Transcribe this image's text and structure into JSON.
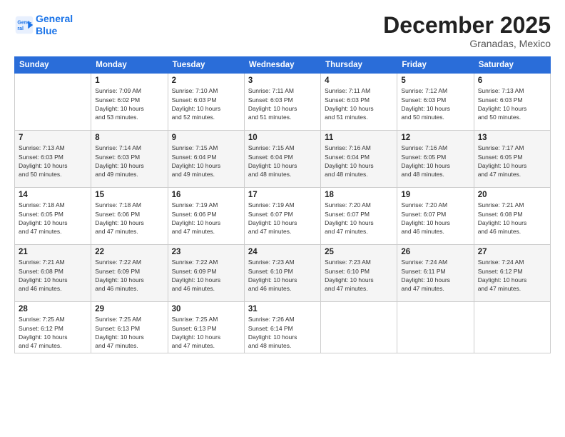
{
  "header": {
    "logo_line1": "General",
    "logo_line2": "Blue",
    "month_year": "December 2025",
    "location": "Granadas, Mexico"
  },
  "weekdays": [
    "Sunday",
    "Monday",
    "Tuesday",
    "Wednesday",
    "Thursday",
    "Friday",
    "Saturday"
  ],
  "weeks": [
    [
      {
        "day": "",
        "info": ""
      },
      {
        "day": "1",
        "info": "Sunrise: 7:09 AM\nSunset: 6:02 PM\nDaylight: 10 hours\nand 53 minutes."
      },
      {
        "day": "2",
        "info": "Sunrise: 7:10 AM\nSunset: 6:03 PM\nDaylight: 10 hours\nand 52 minutes."
      },
      {
        "day": "3",
        "info": "Sunrise: 7:11 AM\nSunset: 6:03 PM\nDaylight: 10 hours\nand 51 minutes."
      },
      {
        "day": "4",
        "info": "Sunrise: 7:11 AM\nSunset: 6:03 PM\nDaylight: 10 hours\nand 51 minutes."
      },
      {
        "day": "5",
        "info": "Sunrise: 7:12 AM\nSunset: 6:03 PM\nDaylight: 10 hours\nand 50 minutes."
      },
      {
        "day": "6",
        "info": "Sunrise: 7:13 AM\nSunset: 6:03 PM\nDaylight: 10 hours\nand 50 minutes."
      }
    ],
    [
      {
        "day": "7",
        "info": "Sunrise: 7:13 AM\nSunset: 6:03 PM\nDaylight: 10 hours\nand 50 minutes."
      },
      {
        "day": "8",
        "info": "Sunrise: 7:14 AM\nSunset: 6:03 PM\nDaylight: 10 hours\nand 49 minutes."
      },
      {
        "day": "9",
        "info": "Sunrise: 7:15 AM\nSunset: 6:04 PM\nDaylight: 10 hours\nand 49 minutes."
      },
      {
        "day": "10",
        "info": "Sunrise: 7:15 AM\nSunset: 6:04 PM\nDaylight: 10 hours\nand 48 minutes."
      },
      {
        "day": "11",
        "info": "Sunrise: 7:16 AM\nSunset: 6:04 PM\nDaylight: 10 hours\nand 48 minutes."
      },
      {
        "day": "12",
        "info": "Sunrise: 7:16 AM\nSunset: 6:05 PM\nDaylight: 10 hours\nand 48 minutes."
      },
      {
        "day": "13",
        "info": "Sunrise: 7:17 AM\nSunset: 6:05 PM\nDaylight: 10 hours\nand 47 minutes."
      }
    ],
    [
      {
        "day": "14",
        "info": "Sunrise: 7:18 AM\nSunset: 6:05 PM\nDaylight: 10 hours\nand 47 minutes."
      },
      {
        "day": "15",
        "info": "Sunrise: 7:18 AM\nSunset: 6:06 PM\nDaylight: 10 hours\nand 47 minutes."
      },
      {
        "day": "16",
        "info": "Sunrise: 7:19 AM\nSunset: 6:06 PM\nDaylight: 10 hours\nand 47 minutes."
      },
      {
        "day": "17",
        "info": "Sunrise: 7:19 AM\nSunset: 6:07 PM\nDaylight: 10 hours\nand 47 minutes."
      },
      {
        "day": "18",
        "info": "Sunrise: 7:20 AM\nSunset: 6:07 PM\nDaylight: 10 hours\nand 47 minutes."
      },
      {
        "day": "19",
        "info": "Sunrise: 7:20 AM\nSunset: 6:07 PM\nDaylight: 10 hours\nand 46 minutes."
      },
      {
        "day": "20",
        "info": "Sunrise: 7:21 AM\nSunset: 6:08 PM\nDaylight: 10 hours\nand 46 minutes."
      }
    ],
    [
      {
        "day": "21",
        "info": "Sunrise: 7:21 AM\nSunset: 6:08 PM\nDaylight: 10 hours\nand 46 minutes."
      },
      {
        "day": "22",
        "info": "Sunrise: 7:22 AM\nSunset: 6:09 PM\nDaylight: 10 hours\nand 46 minutes."
      },
      {
        "day": "23",
        "info": "Sunrise: 7:22 AM\nSunset: 6:09 PM\nDaylight: 10 hours\nand 46 minutes."
      },
      {
        "day": "24",
        "info": "Sunrise: 7:23 AM\nSunset: 6:10 PM\nDaylight: 10 hours\nand 46 minutes."
      },
      {
        "day": "25",
        "info": "Sunrise: 7:23 AM\nSunset: 6:10 PM\nDaylight: 10 hours\nand 47 minutes."
      },
      {
        "day": "26",
        "info": "Sunrise: 7:24 AM\nSunset: 6:11 PM\nDaylight: 10 hours\nand 47 minutes."
      },
      {
        "day": "27",
        "info": "Sunrise: 7:24 AM\nSunset: 6:12 PM\nDaylight: 10 hours\nand 47 minutes."
      }
    ],
    [
      {
        "day": "28",
        "info": "Sunrise: 7:25 AM\nSunset: 6:12 PM\nDaylight: 10 hours\nand 47 minutes."
      },
      {
        "day": "29",
        "info": "Sunrise: 7:25 AM\nSunset: 6:13 PM\nDaylight: 10 hours\nand 47 minutes."
      },
      {
        "day": "30",
        "info": "Sunrise: 7:25 AM\nSunset: 6:13 PM\nDaylight: 10 hours\nand 47 minutes."
      },
      {
        "day": "31",
        "info": "Sunrise: 7:26 AM\nSunset: 6:14 PM\nDaylight: 10 hours\nand 48 minutes."
      },
      {
        "day": "",
        "info": ""
      },
      {
        "day": "",
        "info": ""
      },
      {
        "day": "",
        "info": ""
      }
    ]
  ]
}
